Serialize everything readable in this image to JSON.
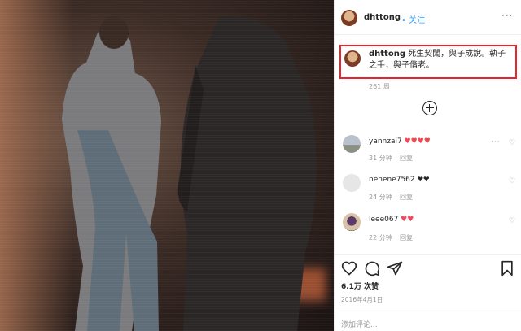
{
  "post": {
    "username": "dhttong",
    "follow_label": "• 关注",
    "caption_user": "dhttong",
    "caption_text": "死生契闊，與子成說。執子之手，與子偕老。",
    "caption_meta": "261 周",
    "likes": "6.1万 次赞",
    "date": "2016年4月1日",
    "comment_placeholder": "添加评论..."
  },
  "comments": [
    {
      "user": "yannzai7",
      "hearts": "♥♥♥♥",
      "time": "31 分钟",
      "reply": "回复"
    },
    {
      "user": "nenene7562",
      "hearts": "❤❤",
      "time": "24 分钟",
      "reply": "回复"
    },
    {
      "user": "leee067",
      "hearts": "♥♥",
      "time": "22 分钟",
      "reply": "回复"
    }
  ],
  "icons": {
    "more": "more-icon",
    "add": "add-comment-icon",
    "like": "heart-icon",
    "comment": "comment-icon",
    "share": "share-icon",
    "save": "bookmark-icon"
  },
  "colors": {
    "highlight": "#e8252a",
    "link": "#3897f0",
    "heart": "#ed4956"
  }
}
